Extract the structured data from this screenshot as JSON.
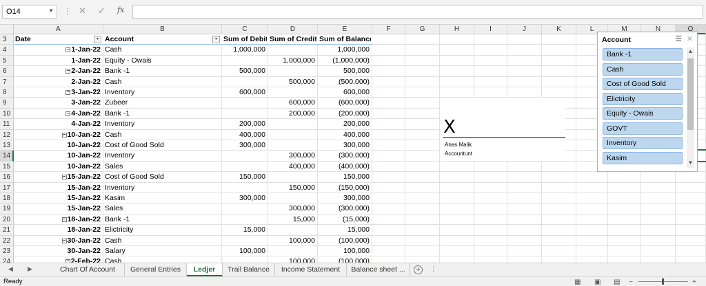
{
  "formula_bar": {
    "name_box": "O14",
    "cancel_icon": "✕",
    "enter_icon": "✓",
    "fx_label": "fx",
    "formula": ""
  },
  "columns": [
    "A",
    "B",
    "C",
    "D",
    "E",
    "F",
    "G",
    "H",
    "I",
    "J",
    "K",
    "L",
    "M",
    "N",
    "O"
  ],
  "row_numbers": [
    "3",
    "4",
    "5",
    "6",
    "7",
    "8",
    "9",
    "10",
    "11",
    "12",
    "13",
    "14",
    "15",
    "16",
    "17",
    "18",
    "19",
    "20",
    "21",
    "22",
    "23",
    "24"
  ],
  "pivot": {
    "headers": {
      "date": "Date",
      "account": "Account",
      "debit": "Sum of Debit",
      "credit": "Sum of Credit",
      "balance": "Sum of Balance"
    },
    "rows": [
      {
        "date": "1-Jan-22",
        "group": true,
        "account": "Cash",
        "debit": "1,000,000",
        "credit": "",
        "balance": "1,000,000"
      },
      {
        "date": "1-Jan-22",
        "group": false,
        "account": "Equity - Owais",
        "debit": "",
        "credit": "1,000,000",
        "balance": "(1,000,000)"
      },
      {
        "date": "2-Jan-22",
        "group": true,
        "account": "Bank -1",
        "debit": "500,000",
        "credit": "",
        "balance": "500,000"
      },
      {
        "date": "2-Jan-22",
        "group": false,
        "account": "Cash",
        "debit": "",
        "credit": "500,000",
        "balance": "(500,000)"
      },
      {
        "date": "3-Jan-22",
        "group": true,
        "account": "Inventory",
        "debit": "600,000",
        "credit": "",
        "balance": "600,000"
      },
      {
        "date": "3-Jan-22",
        "group": false,
        "account": "Zubeer",
        "debit": "",
        "credit": "600,000",
        "balance": "(600,000)"
      },
      {
        "date": "4-Jan-22",
        "group": true,
        "account": "Bank -1",
        "debit": "",
        "credit": "200,000",
        "balance": "(200,000)"
      },
      {
        "date": "4-Jan-22",
        "group": false,
        "account": "Inventory",
        "debit": "200,000",
        "credit": "",
        "balance": "200,000"
      },
      {
        "date": "10-Jan-22",
        "group": true,
        "account": "Cash",
        "debit": "400,000",
        "credit": "",
        "balance": "400,000"
      },
      {
        "date": "10-Jan-22",
        "group": false,
        "account": "Cost of Good Sold",
        "debit": "300,000",
        "credit": "",
        "balance": "300,000"
      },
      {
        "date": "10-Jan-22",
        "group": false,
        "account": "Inventory",
        "debit": "",
        "credit": "300,000",
        "balance": "(300,000)"
      },
      {
        "date": "10-Jan-22",
        "group": false,
        "account": "Sales",
        "debit": "",
        "credit": "400,000",
        "balance": "(400,000)"
      },
      {
        "date": "15-Jan-22",
        "group": true,
        "account": "Cost of Good Sold",
        "debit": "150,000",
        "credit": "",
        "balance": "150,000"
      },
      {
        "date": "15-Jan-22",
        "group": false,
        "account": "Inventory",
        "debit": "",
        "credit": "150,000",
        "balance": "(150,000)"
      },
      {
        "date": "15-Jan-22",
        "group": false,
        "account": "Kasim",
        "debit": "300,000",
        "credit": "",
        "balance": "300,000"
      },
      {
        "date": "15-Jan-22",
        "group": false,
        "account": "Sales",
        "debit": "",
        "credit": "300,000",
        "balance": "(300,000)"
      },
      {
        "date": "18-Jan-22",
        "group": true,
        "account": "Bank -1",
        "debit": "",
        "credit": "15,000",
        "balance": "(15,000)"
      },
      {
        "date": "18-Jan-22",
        "group": false,
        "account": "Elictricity",
        "debit": "15,000",
        "credit": "",
        "balance": "15,000"
      },
      {
        "date": "30-Jan-22",
        "group": true,
        "account": "Cash",
        "debit": "",
        "credit": "100,000",
        "balance": "(100,000)"
      },
      {
        "date": "30-Jan-22",
        "group": false,
        "account": "Salary",
        "debit": "100,000",
        "credit": "",
        "balance": "100,000"
      },
      {
        "date": "2-Feb-22",
        "group": true,
        "account": "Cash",
        "debit": "",
        "credit": "100,000",
        "balance": "(100,000)"
      }
    ]
  },
  "signature": {
    "mark": "X",
    "name": "Anas Malik",
    "role": "Accountunt"
  },
  "slicer": {
    "title": "Account",
    "items": [
      "Bank -1",
      "Cash",
      "Cost of Good Sold",
      "Elictricity",
      "Equity - Owais",
      "GOVT",
      "Inventory",
      "Kasim"
    ]
  },
  "sheet_tabs": [
    "Chart Of Account",
    "General Entries",
    "Ledjer",
    "Trail Balance",
    "Income Statement",
    "Balance sheet ..."
  ],
  "active_tab": "Ledjer",
  "status": {
    "ready": "Ready"
  },
  "colors": {
    "accent": "#217346",
    "slicer_item": "#bdd7ee",
    "pivot_header_line": "#9bc2e6"
  }
}
